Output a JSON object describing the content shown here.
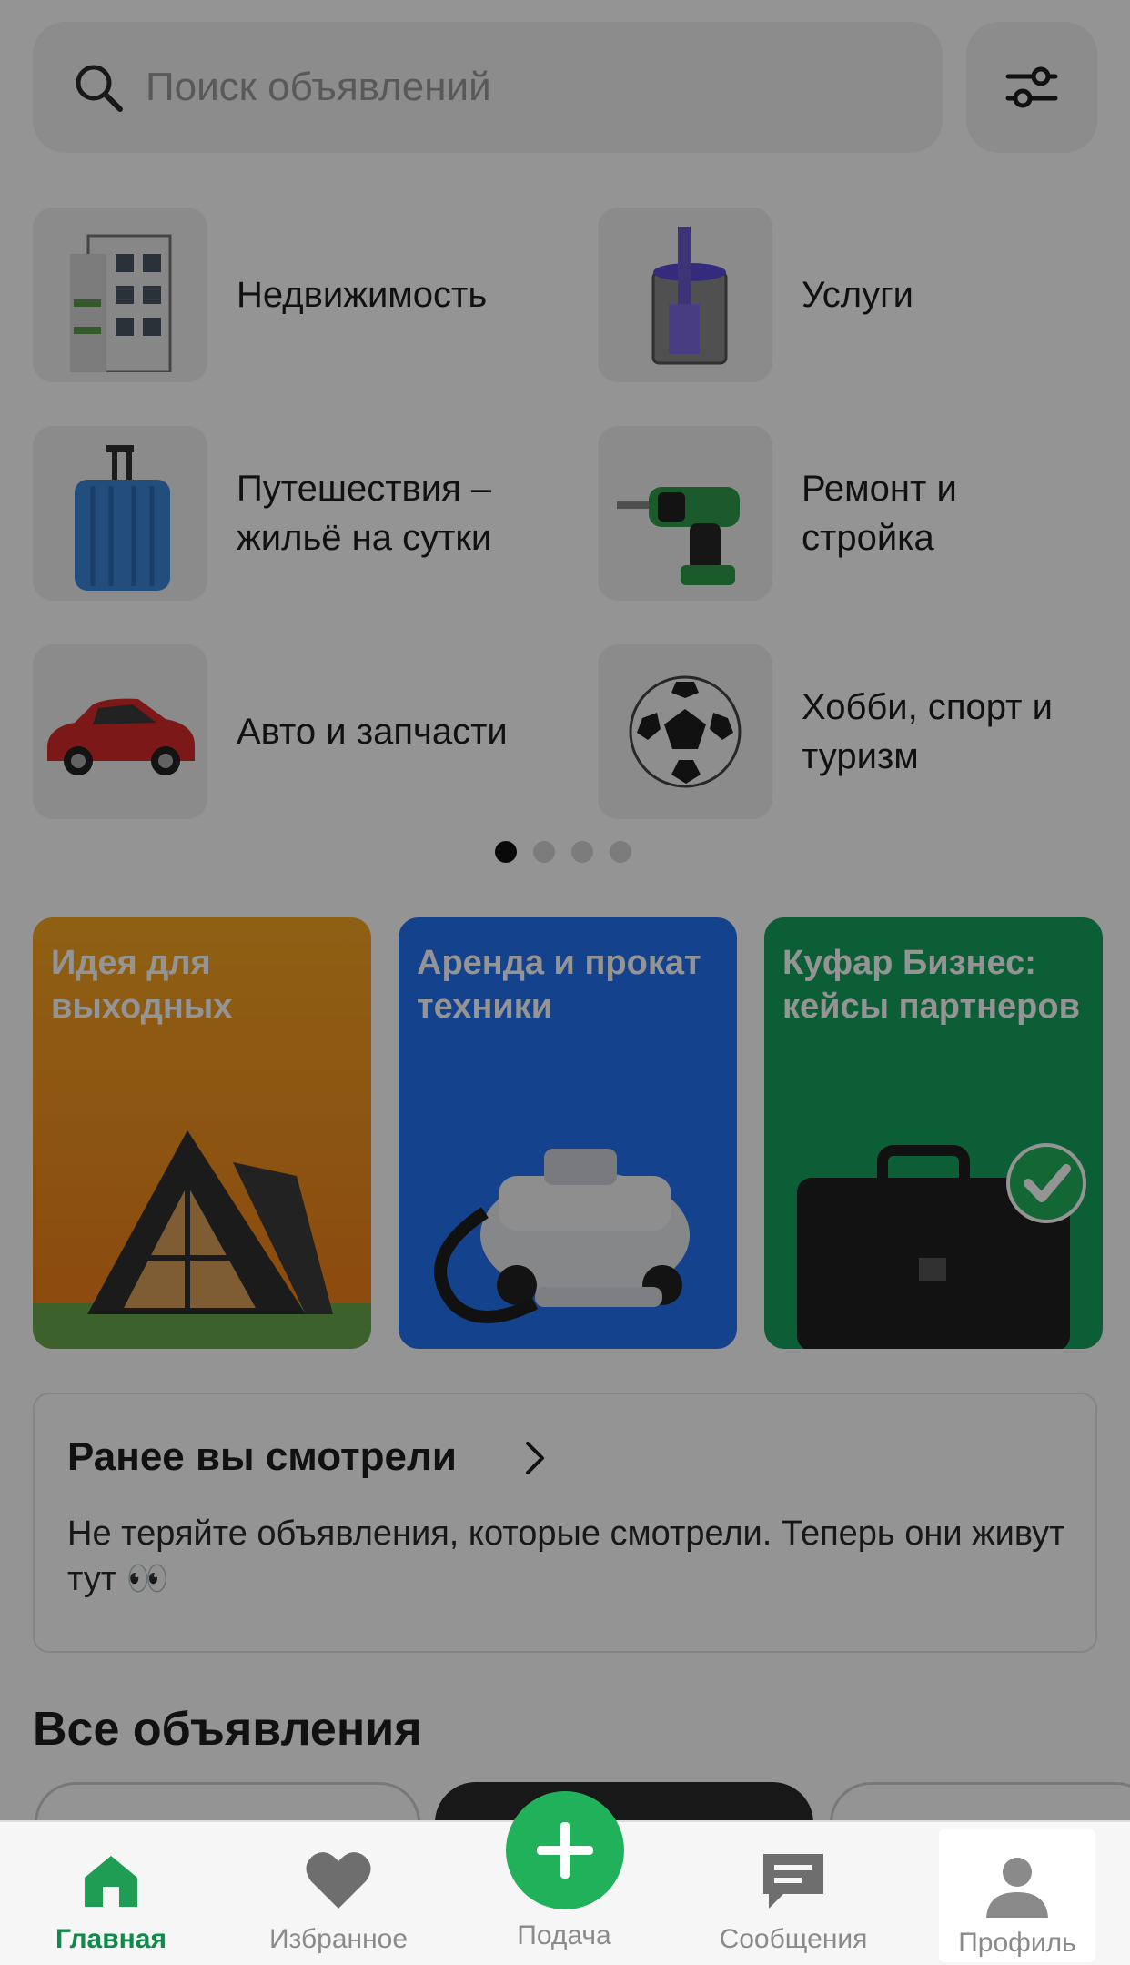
{
  "search": {
    "placeholder": "Поиск объявлений"
  },
  "categories": [
    {
      "label": "Недвижимость",
      "icon": "building-icon"
    },
    {
      "label": "Услуги",
      "icon": "paint-can-icon"
    },
    {
      "label": "Путешествия – жильё на сутки",
      "icon": "suitcase-icon"
    },
    {
      "label": "Ремонт и стройка",
      "icon": "drill-icon"
    },
    {
      "label": "Авто и запчасти",
      "icon": "car-icon"
    },
    {
      "label": "Хобби, спорт и туризм",
      "icon": "football-icon"
    }
  ],
  "carousel": {
    "pages": 4,
    "active": 1
  },
  "promos": [
    {
      "title": "Идея для выходных",
      "color": "#f5a623"
    },
    {
      "title": "Аренда и прокат техники",
      "color": "#2573f2"
    },
    {
      "title": "Куфар Бизнес: кейсы партнеров",
      "color": "#16a35f"
    }
  ],
  "recent": {
    "title": "Ранее вы смотрели",
    "text": "Не теряйте объявления, которые смотрели. Теперь они живут тут 👀"
  },
  "all_listings": {
    "title": "Все объявления"
  },
  "tabbar": {
    "home": "Главная",
    "favorites": "Избранное",
    "post": "Подача",
    "messages": "Сообщения",
    "profile": "Профиль"
  },
  "colors": {
    "accent": "#22b15b",
    "active_tab": "#0f8a4a"
  }
}
